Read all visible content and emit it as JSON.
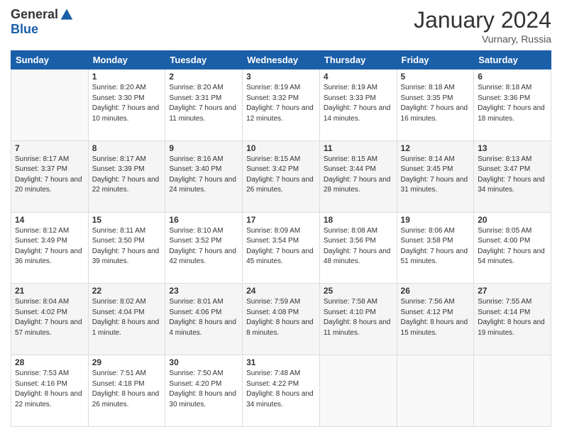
{
  "header": {
    "logo_general": "General",
    "logo_blue": "Blue",
    "month_title": "January 2024",
    "location": "Vurnary, Russia"
  },
  "days_of_week": [
    "Sunday",
    "Monday",
    "Tuesday",
    "Wednesday",
    "Thursday",
    "Friday",
    "Saturday"
  ],
  "weeks": [
    [
      {
        "day": "",
        "sunrise": "",
        "sunset": "",
        "daylight": ""
      },
      {
        "day": "1",
        "sunrise": "Sunrise: 8:20 AM",
        "sunset": "Sunset: 3:30 PM",
        "daylight": "Daylight: 7 hours and 10 minutes."
      },
      {
        "day": "2",
        "sunrise": "Sunrise: 8:20 AM",
        "sunset": "Sunset: 3:31 PM",
        "daylight": "Daylight: 7 hours and 11 minutes."
      },
      {
        "day": "3",
        "sunrise": "Sunrise: 8:19 AM",
        "sunset": "Sunset: 3:32 PM",
        "daylight": "Daylight: 7 hours and 12 minutes."
      },
      {
        "day": "4",
        "sunrise": "Sunrise: 8:19 AM",
        "sunset": "Sunset: 3:33 PM",
        "daylight": "Daylight: 7 hours and 14 minutes."
      },
      {
        "day": "5",
        "sunrise": "Sunrise: 8:18 AM",
        "sunset": "Sunset: 3:35 PM",
        "daylight": "Daylight: 7 hours and 16 minutes."
      },
      {
        "day": "6",
        "sunrise": "Sunrise: 8:18 AM",
        "sunset": "Sunset: 3:36 PM",
        "daylight": "Daylight: 7 hours and 18 minutes."
      }
    ],
    [
      {
        "day": "7",
        "sunrise": "Sunrise: 8:17 AM",
        "sunset": "Sunset: 3:37 PM",
        "daylight": "Daylight: 7 hours and 20 minutes."
      },
      {
        "day": "8",
        "sunrise": "Sunrise: 8:17 AM",
        "sunset": "Sunset: 3:39 PM",
        "daylight": "Daylight: 7 hours and 22 minutes."
      },
      {
        "day": "9",
        "sunrise": "Sunrise: 8:16 AM",
        "sunset": "Sunset: 3:40 PM",
        "daylight": "Daylight: 7 hours and 24 minutes."
      },
      {
        "day": "10",
        "sunrise": "Sunrise: 8:15 AM",
        "sunset": "Sunset: 3:42 PM",
        "daylight": "Daylight: 7 hours and 26 minutes."
      },
      {
        "day": "11",
        "sunrise": "Sunrise: 8:15 AM",
        "sunset": "Sunset: 3:44 PM",
        "daylight": "Daylight: 7 hours and 28 minutes."
      },
      {
        "day": "12",
        "sunrise": "Sunrise: 8:14 AM",
        "sunset": "Sunset: 3:45 PM",
        "daylight": "Daylight: 7 hours and 31 minutes."
      },
      {
        "day": "13",
        "sunrise": "Sunrise: 8:13 AM",
        "sunset": "Sunset: 3:47 PM",
        "daylight": "Daylight: 7 hours and 34 minutes."
      }
    ],
    [
      {
        "day": "14",
        "sunrise": "Sunrise: 8:12 AM",
        "sunset": "Sunset: 3:49 PM",
        "daylight": "Daylight: 7 hours and 36 minutes."
      },
      {
        "day": "15",
        "sunrise": "Sunrise: 8:11 AM",
        "sunset": "Sunset: 3:50 PM",
        "daylight": "Daylight: 7 hours and 39 minutes."
      },
      {
        "day": "16",
        "sunrise": "Sunrise: 8:10 AM",
        "sunset": "Sunset: 3:52 PM",
        "daylight": "Daylight: 7 hours and 42 minutes."
      },
      {
        "day": "17",
        "sunrise": "Sunrise: 8:09 AM",
        "sunset": "Sunset: 3:54 PM",
        "daylight": "Daylight: 7 hours and 45 minutes."
      },
      {
        "day": "18",
        "sunrise": "Sunrise: 8:08 AM",
        "sunset": "Sunset: 3:56 PM",
        "daylight": "Daylight: 7 hours and 48 minutes."
      },
      {
        "day": "19",
        "sunrise": "Sunrise: 8:06 AM",
        "sunset": "Sunset: 3:58 PM",
        "daylight": "Daylight: 7 hours and 51 minutes."
      },
      {
        "day": "20",
        "sunrise": "Sunrise: 8:05 AM",
        "sunset": "Sunset: 4:00 PM",
        "daylight": "Daylight: 7 hours and 54 minutes."
      }
    ],
    [
      {
        "day": "21",
        "sunrise": "Sunrise: 8:04 AM",
        "sunset": "Sunset: 4:02 PM",
        "daylight": "Daylight: 7 hours and 57 minutes."
      },
      {
        "day": "22",
        "sunrise": "Sunrise: 8:02 AM",
        "sunset": "Sunset: 4:04 PM",
        "daylight": "Daylight: 8 hours and 1 minute."
      },
      {
        "day": "23",
        "sunrise": "Sunrise: 8:01 AM",
        "sunset": "Sunset: 4:06 PM",
        "daylight": "Daylight: 8 hours and 4 minutes."
      },
      {
        "day": "24",
        "sunrise": "Sunrise: 7:59 AM",
        "sunset": "Sunset: 4:08 PM",
        "daylight": "Daylight: 8 hours and 8 minutes."
      },
      {
        "day": "25",
        "sunrise": "Sunrise: 7:58 AM",
        "sunset": "Sunset: 4:10 PM",
        "daylight": "Daylight: 8 hours and 11 minutes."
      },
      {
        "day": "26",
        "sunrise": "Sunrise: 7:56 AM",
        "sunset": "Sunset: 4:12 PM",
        "daylight": "Daylight: 8 hours and 15 minutes."
      },
      {
        "day": "27",
        "sunrise": "Sunrise: 7:55 AM",
        "sunset": "Sunset: 4:14 PM",
        "daylight": "Daylight: 8 hours and 19 minutes."
      }
    ],
    [
      {
        "day": "28",
        "sunrise": "Sunrise: 7:53 AM",
        "sunset": "Sunset: 4:16 PM",
        "daylight": "Daylight: 8 hours and 22 minutes."
      },
      {
        "day": "29",
        "sunrise": "Sunrise: 7:51 AM",
        "sunset": "Sunset: 4:18 PM",
        "daylight": "Daylight: 8 hours and 26 minutes."
      },
      {
        "day": "30",
        "sunrise": "Sunrise: 7:50 AM",
        "sunset": "Sunset: 4:20 PM",
        "daylight": "Daylight: 8 hours and 30 minutes."
      },
      {
        "day": "31",
        "sunrise": "Sunrise: 7:48 AM",
        "sunset": "Sunset: 4:22 PM",
        "daylight": "Daylight: 8 hours and 34 minutes."
      },
      {
        "day": "",
        "sunrise": "",
        "sunset": "",
        "daylight": ""
      },
      {
        "day": "",
        "sunrise": "",
        "sunset": "",
        "daylight": ""
      },
      {
        "day": "",
        "sunrise": "",
        "sunset": "",
        "daylight": ""
      }
    ]
  ]
}
